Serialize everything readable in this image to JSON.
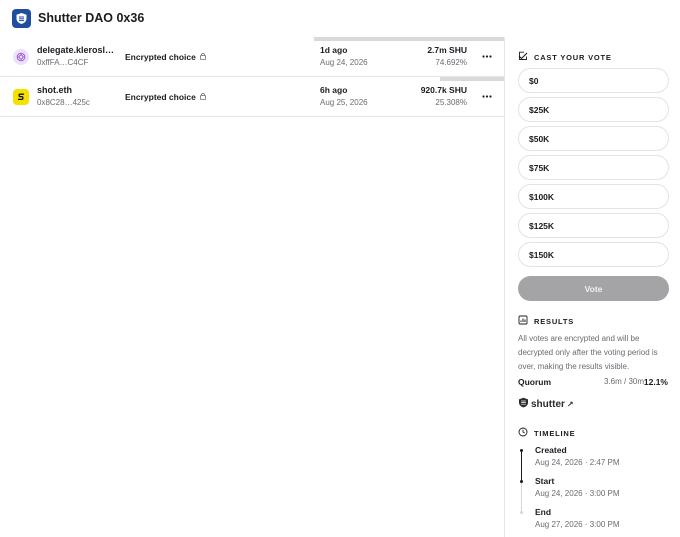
{
  "header": {
    "dao_name": "Shutter DAO 0x36"
  },
  "votes": [
    {
      "name": "delegate.kleroslabs.eth",
      "address": "0xffFA…C4CF",
      "choice": "Encrypted choice",
      "time_relative": "1d ago",
      "date": "Aug 24, 2026",
      "power": "2.7m SHU",
      "percent": "74.692%",
      "bar_fraction": 0.74692,
      "avatar_color": "#e9d5ff"
    },
    {
      "name": "shot.eth",
      "address": "0x8C28…425c",
      "choice": "Encrypted choice",
      "time_relative": "6h ago",
      "date": "Aug 25, 2026",
      "power": "920.7k SHU",
      "percent": "25.308%",
      "bar_fraction": 0.25308,
      "avatar_color": "#f5e000"
    }
  ],
  "cast_vote": {
    "title": "CAST YOUR VOTE",
    "options": [
      "$0",
      "$25K",
      "$50K",
      "$75K",
      "$100K",
      "$125K",
      "$150K"
    ],
    "vote_button": "Vote"
  },
  "results": {
    "title": "RESULTS",
    "description": "All votes are encrypted and will be decrypted only after the voting period is over, making the results visible.",
    "quorum_label": "Quorum",
    "quorum_value": "3.6m / 30m",
    "quorum_percent": "12.1%",
    "shutter_label": "shutter",
    "shutter_arrow": "↗"
  },
  "timeline": {
    "title": "TIMELINE",
    "events": [
      {
        "label": "Created",
        "date": "Aug 24, 2026 · 2:47 PM"
      },
      {
        "label": "Start",
        "date": "Aug 24, 2026 · 3:00 PM"
      },
      {
        "label": "End",
        "date": "Aug 27, 2026 · 3:00 PM"
      }
    ]
  },
  "colors": {
    "accent_dao": "#1f4e9e",
    "vote_button_disabled": "#a4a4a7",
    "bar": "#d9d9d9",
    "muted_text": "#6b6b72"
  },
  "icons": [
    "dao-shield-icon",
    "lock-icon",
    "more-icon",
    "checkbox-icon",
    "results-icon",
    "clock-icon",
    "external-link-icon"
  ]
}
